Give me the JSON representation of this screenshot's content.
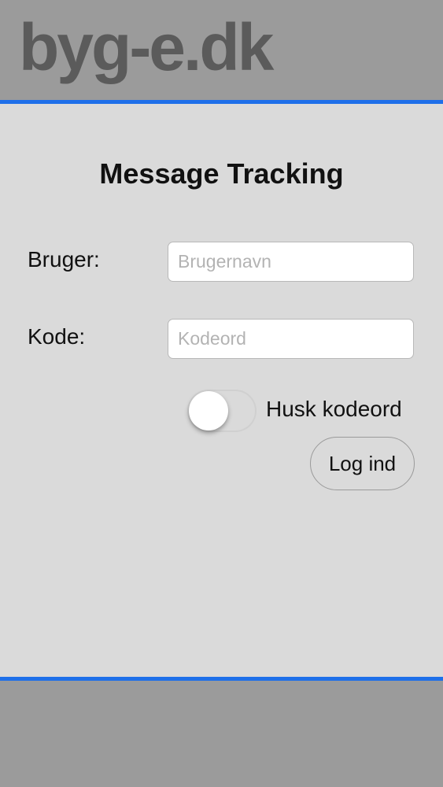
{
  "header": {
    "logo_text": "byg-e.dk"
  },
  "main": {
    "title": "Message Tracking",
    "username": {
      "label": "Bruger:",
      "placeholder": "Brugernavn",
      "value": ""
    },
    "password": {
      "label": "Kode:",
      "placeholder": "Kodeord",
      "value": ""
    },
    "remember": {
      "label": "Husk kodeord",
      "on": false
    },
    "login_button": "Log ind"
  },
  "colors": {
    "accent_line": "#1e6fe9",
    "header_bg": "#9b9b9b",
    "content_bg": "#dadada",
    "logo": "#5b5b5b"
  }
}
